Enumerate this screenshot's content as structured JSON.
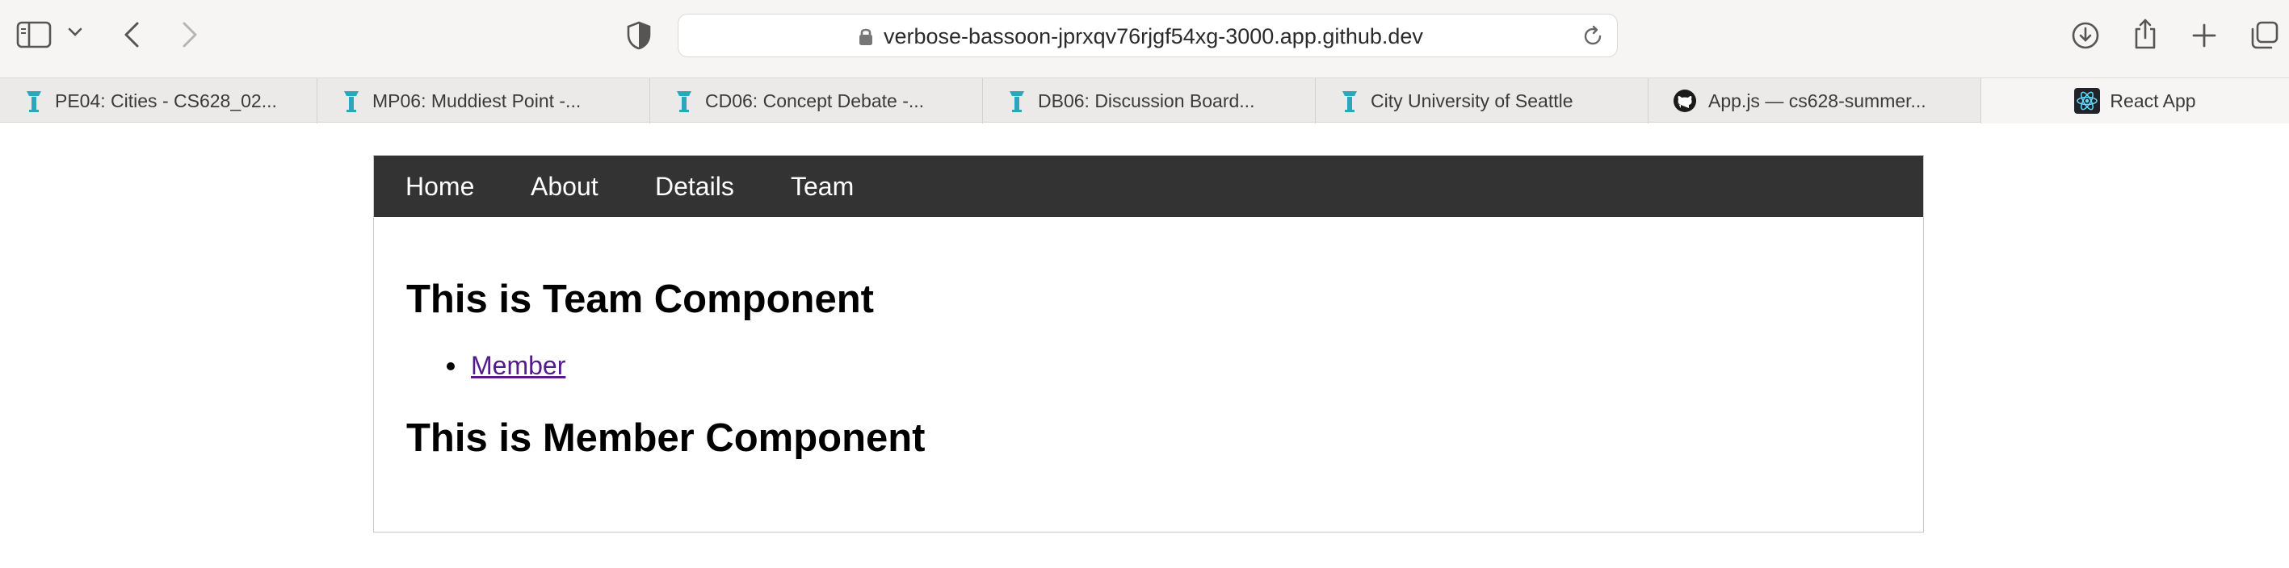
{
  "browser": {
    "url": "verbose-bassoon-jprxqv76rjgf54xg-3000.app.github.dev",
    "tabs": [
      {
        "label": "PE04: Cities - CS628_02...",
        "icon": "cityu-icon"
      },
      {
        "label": "MP06: Muddiest Point -...",
        "icon": "cityu-icon"
      },
      {
        "label": "CD06: Concept Debate -...",
        "icon": "cityu-icon"
      },
      {
        "label": "DB06: Discussion Board...",
        "icon": "cityu-icon"
      },
      {
        "label": "City University of Seattle",
        "icon": "cityu-icon"
      },
      {
        "label": "App.js — cs628-summer...",
        "icon": "github-icon"
      },
      {
        "label": "React App",
        "icon": "react-icon",
        "active": true
      }
    ]
  },
  "nav": {
    "items": [
      "Home",
      "About",
      "Details",
      "Team"
    ]
  },
  "main": {
    "team_heading": "This is Team Component",
    "links": [
      "Member"
    ],
    "member_heading": "This is Member Component"
  },
  "colors": {
    "nav_bg": "#333333",
    "nav_text": "#ffffff",
    "visited_link": "#551a8b",
    "tab_icon": "#2aa7b8"
  }
}
